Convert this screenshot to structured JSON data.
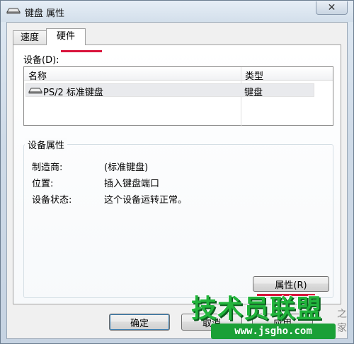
{
  "window": {
    "title": "键盘 属性",
    "close_glyph": "✕"
  },
  "tabs": [
    {
      "label": "速度",
      "active": false
    },
    {
      "label": "硬件",
      "active": true
    }
  ],
  "devices": {
    "label": "设备(D):",
    "columns": {
      "name": "名称",
      "type": "类型"
    },
    "rows": [
      {
        "name": "PS/2 标准键盘",
        "type": "键盘",
        "icon": "keyboard-icon"
      }
    ]
  },
  "device_properties": {
    "title": "设备属性",
    "manufacturer_label": "制造商:",
    "manufacturer_value": "(标准键盘)",
    "location_label": "位置:",
    "location_value": "插入键盘端口",
    "status_label": "设备状态:",
    "status_value": "这个设备运转正常。",
    "properties_button": "属性(R)"
  },
  "buttons": {
    "ok": "确定",
    "cancel": "取消",
    "apply": "应用"
  },
  "watermark": {
    "brand": "技术员联盟",
    "url": "www.jsgho.com",
    "corner": "之家"
  },
  "colors": {
    "accent_underline": "#d9143c",
    "watermark_green": "#22b43c"
  }
}
